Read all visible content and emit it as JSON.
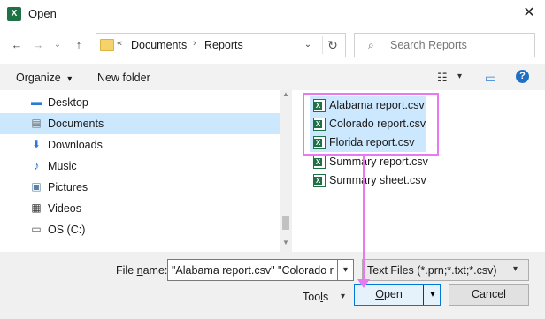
{
  "window": {
    "title": "Open",
    "app_icon": "excel-icon",
    "close_glyph": "✕"
  },
  "nav": {
    "back": "←",
    "forward": "→",
    "dropdown": "⌄",
    "up": "↑"
  },
  "address": {
    "overflow": "«",
    "crumbs": [
      "Documents",
      "Reports"
    ],
    "separator": "›",
    "dropdown": "⌄",
    "refresh": "↻"
  },
  "search": {
    "placeholder": "Search Reports",
    "icon": "⌕"
  },
  "toolbar": {
    "organize": "Organize",
    "organize_arrow": "▾",
    "new_folder": "New folder",
    "view_icon": "☷",
    "view_arrow": "▾",
    "pane_icon": "▭",
    "help_icon": "?"
  },
  "nav_pane": {
    "items": [
      {
        "label": "Desktop",
        "icon": "desktop-icon",
        "glyph": "▬",
        "color": "#2b7bd6",
        "selected": false
      },
      {
        "label": "Documents",
        "icon": "documents-icon",
        "glyph": "▤",
        "color": "#6d6d6d",
        "selected": true
      },
      {
        "label": "Downloads",
        "icon": "downloads-icon",
        "glyph": "⬇",
        "color": "#2b7bd6",
        "selected": false
      },
      {
        "label": "Music",
        "icon": "music-icon",
        "glyph": "♪",
        "color": "#2b7bd6",
        "selected": false
      },
      {
        "label": "Pictures",
        "icon": "pictures-icon",
        "glyph": "▣",
        "color": "#5a7ea6",
        "selected": false
      },
      {
        "label": "Videos",
        "icon": "videos-icon",
        "glyph": "▦",
        "color": "#3a3a3a",
        "selected": false
      },
      {
        "label": "OS (C:)",
        "icon": "drive-icon",
        "glyph": "▭",
        "color": "#555555",
        "selected": false
      }
    ]
  },
  "files": {
    "items": [
      {
        "name": "Alabama report.csv",
        "selected": true
      },
      {
        "name": "Colorado report.csv",
        "selected": true
      },
      {
        "name": "Florida report.csv",
        "selected": true
      },
      {
        "name": "Summary report.csv",
        "selected": false
      },
      {
        "name": "Summary sheet.csv",
        "selected": false
      }
    ],
    "icon_letter": "X"
  },
  "bottom": {
    "file_name_label_prefix": "File ",
    "file_name_label_u": "n",
    "file_name_label_suffix": "ame:",
    "file_name_value": "\"Alabama report.csv\" \"Colorado report.csv\" \"Florida report.csv\"",
    "file_type": "Text Files (*.prn;*.txt;*.csv)",
    "tools_prefix": "Too",
    "tools_u": "l",
    "tools_suffix": "s",
    "open_u": "O",
    "open_suffix": "pen",
    "cancel": "Cancel",
    "arrow": "▾"
  },
  "colors": {
    "selection": "#cce8ff",
    "annotation": "#e879f0",
    "excel_green": "#1e7145",
    "primary_border": "#0078d7"
  }
}
